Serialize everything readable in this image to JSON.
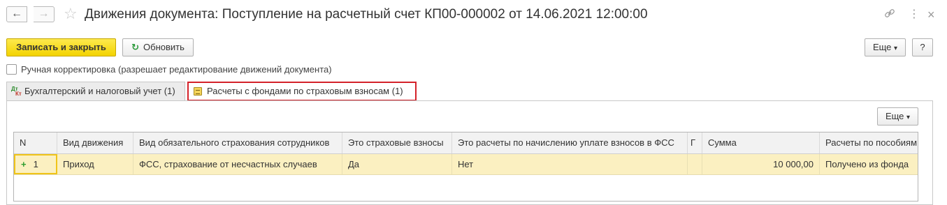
{
  "window": {
    "title": "Движения документа: Поступление на расчетный счет КП00-000002 от 14.06.2021 12:00:00",
    "back_icon": "←",
    "forward_icon": "→",
    "favorite_icon": "☆",
    "link_icon": "🔗",
    "more_icon": "⋮",
    "close_icon": "×"
  },
  "toolbar": {
    "save_close_label": "Записать и закрыть",
    "refresh_icon": "↻",
    "refresh_label": "Обновить",
    "more_label": "Еще",
    "more_arrow": "▾",
    "help_label": "?"
  },
  "manual_correction": {
    "label": "Ручная корректировка (разрешает редактирование движений документа)",
    "checked": false
  },
  "tabs": [
    {
      "label": "Бухгалтерский и налоговый учет (1)",
      "icon": "dt-kt-icon",
      "active": false
    },
    {
      "label": "Расчеты с фондами по страховым взносам (1)",
      "icon": "ledger-icon",
      "active": true
    }
  ],
  "panel": {
    "more_label": "Еще",
    "more_arrow": "▾"
  },
  "table": {
    "columns": [
      "N",
      "Вид движения",
      "Вид обязательного страхования сотрудников",
      "Это страховые взносы",
      "Это расчеты по начислению уплате взносов в ФСС",
      "Г",
      "Сумма",
      "Расчеты по пособиям"
    ],
    "rows": [
      {
        "marker": "+",
        "n": "1",
        "movement": "Приход",
        "insurance_type": "ФСС, страхование от несчастных случаев",
        "is_contributions": "Да",
        "is_fss_settlement": "Нет",
        "g": "",
        "amount": "10 000,00",
        "benefits": "Получено из фонда"
      }
    ]
  },
  "colors": {
    "primary_button": "#f3d300",
    "selected_row": "#fbf0c1",
    "active_tab_outline": "#d4222a"
  }
}
